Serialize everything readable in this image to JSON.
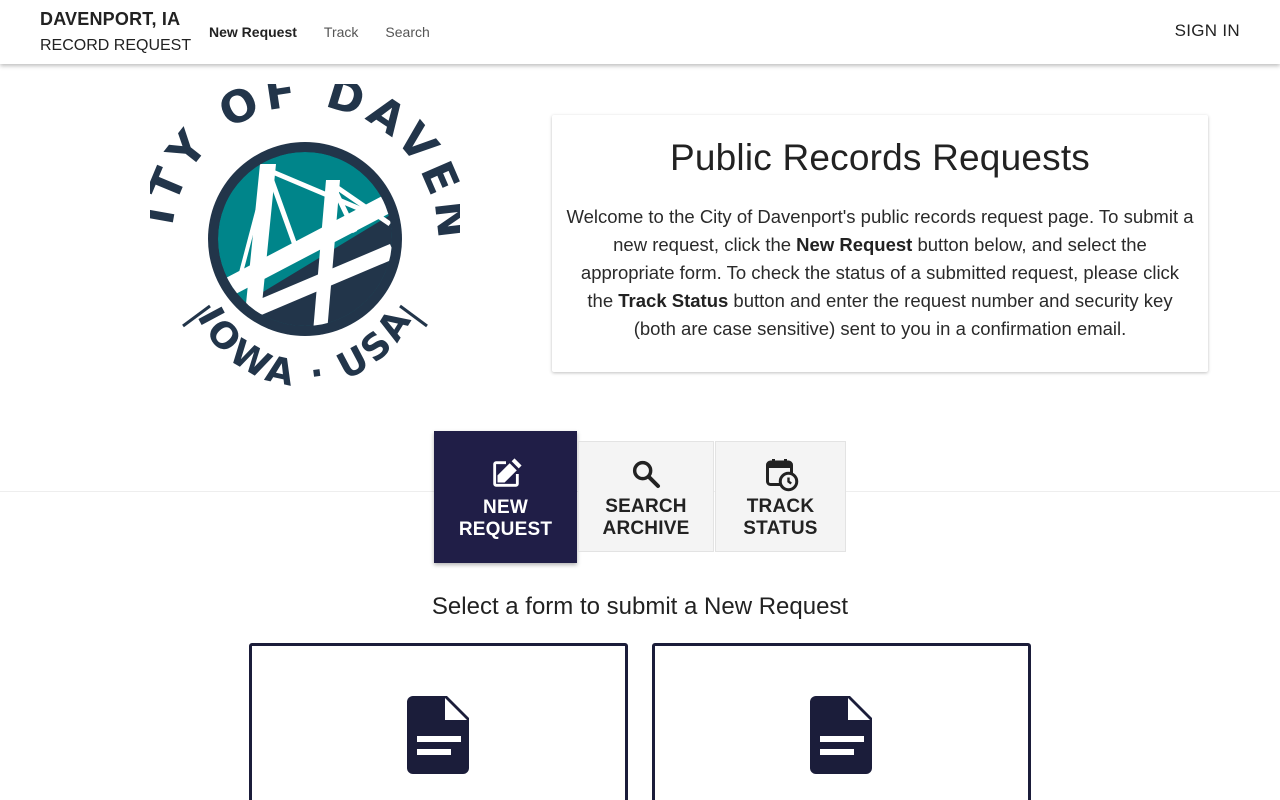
{
  "header": {
    "city": "DAVENPORT, IA",
    "subtitle": "RECORD REQUEST",
    "nav": [
      {
        "label": "New Request",
        "active": true
      },
      {
        "label": "Track",
        "active": false
      },
      {
        "label": "Search",
        "active": false
      }
    ],
    "signin_label": "SIGN IN"
  },
  "logo": {
    "arc_top": "THE CITY OF DAVENPORT",
    "arc_bottom": "IOWA · USA",
    "colors": {
      "navy": "#22354a",
      "teal": "#00858a"
    }
  },
  "intro": {
    "title": "Public Records Requests",
    "text_1": "Welcome to the City of Davenport's public records request page. To submit a new request, click the ",
    "bold_1": "New Request",
    "text_2": " button below, and select the appropriate form. To check the status of a submitted request, please click the ",
    "bold_2": "Track Status",
    "text_3": " button and enter the request number and security key (both are case sensitive) sent to you in a confirmation email."
  },
  "actions": [
    {
      "line1": "NEW",
      "line2": "REQUEST",
      "icon": "edit-icon",
      "active": true
    },
    {
      "line1": "SEARCH",
      "line2": "ARCHIVE",
      "icon": "search-icon",
      "active": false
    },
    {
      "line1": "TRACK",
      "line2": "STATUS",
      "icon": "calendar-clock-icon",
      "active": false
    }
  ],
  "select_heading": "Select a form to submit a New Request",
  "forms": [
    {
      "icon": "document-icon"
    },
    {
      "icon": "document-icon"
    }
  ],
  "colors": {
    "accent": "#201e47",
    "tile_border": "#1b1d3a",
    "inactive_bg": "#f4f4f4"
  }
}
